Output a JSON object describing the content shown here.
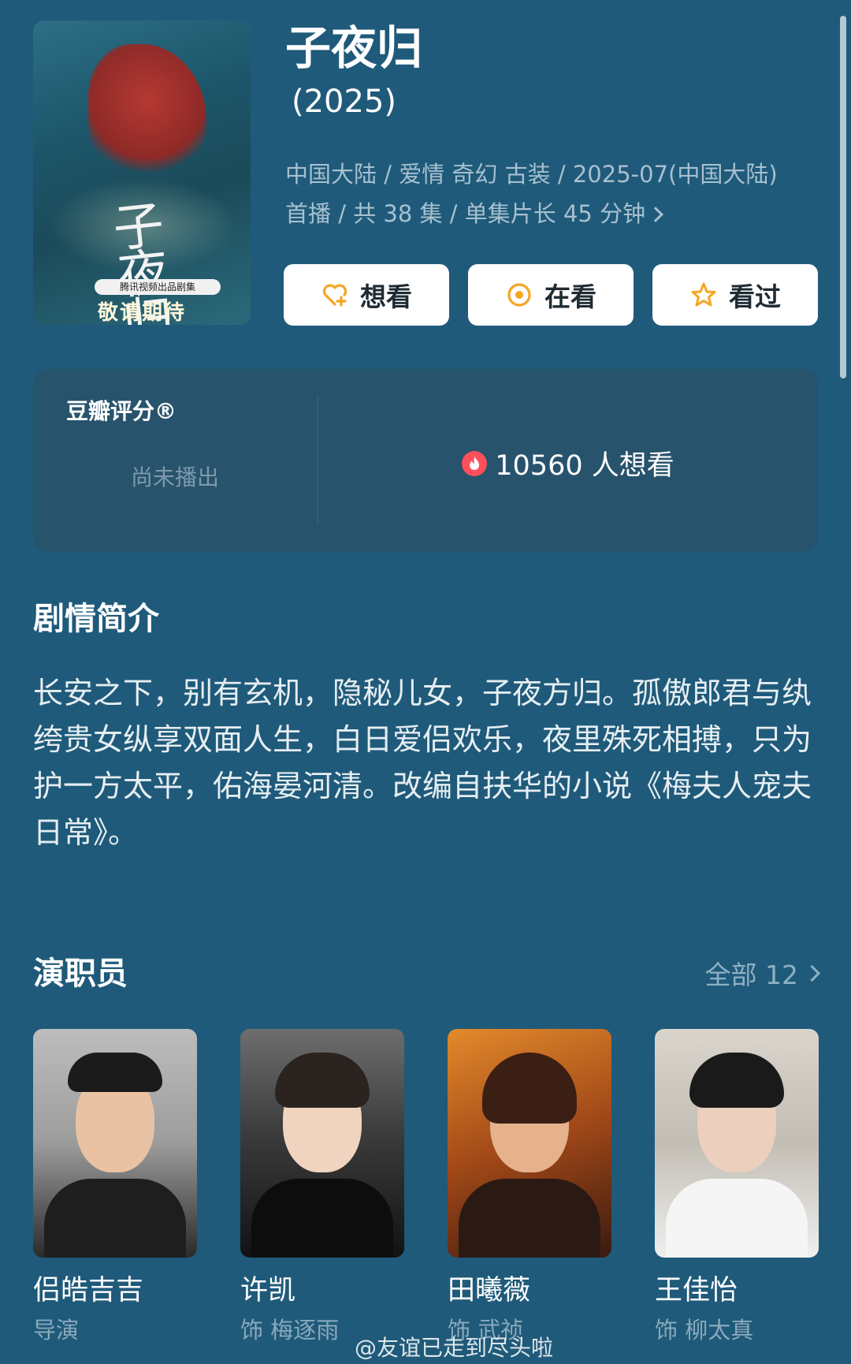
{
  "show": {
    "title": "子夜归",
    "year": "(2025)",
    "meta_line1": "中国大陆 / 爱情 奇幻 古装 / 2025-07(中国大陆)",
    "meta_line2": "首播 / 共 38 集 / 单集片长 45 分钟",
    "poster": {
      "calligraphy": "子夜归",
      "tag": "腾讯视频出品剧集",
      "bottom_text": "敬请期待"
    }
  },
  "actions": {
    "want_label": "想看",
    "watching_label": "在看",
    "watched_label": "看过"
  },
  "rating": {
    "label": "豆瓣评分®",
    "status": "尚未播出",
    "want_count_text": "10560 人想看"
  },
  "synopsis": {
    "heading": "剧情简介",
    "text": "长安之下，别有玄机，隐秘儿女，子夜方归。孤傲郎君与纨绔贵女纵享双面人生，白日爱侣欢乐，夜里殊死相搏，只为护一方太平，佑海晏河清。改编自扶华的小说《梅夫人宠夫日常》。"
  },
  "cast": {
    "heading": "演职员",
    "all_label": "全部 12",
    "members": [
      {
        "name": "侣皓吉吉",
        "role": "导演"
      },
      {
        "name": "许凯",
        "role": "饰 梅逐雨"
      },
      {
        "name": "田曦薇",
        "role": "饰 武祯"
      },
      {
        "name": "王佳怡",
        "role": "饰 柳太真"
      }
    ]
  },
  "watermark": "@友谊已走到尽头啦",
  "colors": {
    "background": "#1f5a7a",
    "card": "#28536c",
    "muted_text": "#a7c0cf",
    "accent_orange": "#f5a623",
    "hot_red": "#ff4f5a"
  },
  "icons": [
    "heart-plus-icon",
    "target-circle-icon",
    "star-icon",
    "fire-icon",
    "chevron-right-icon"
  ]
}
